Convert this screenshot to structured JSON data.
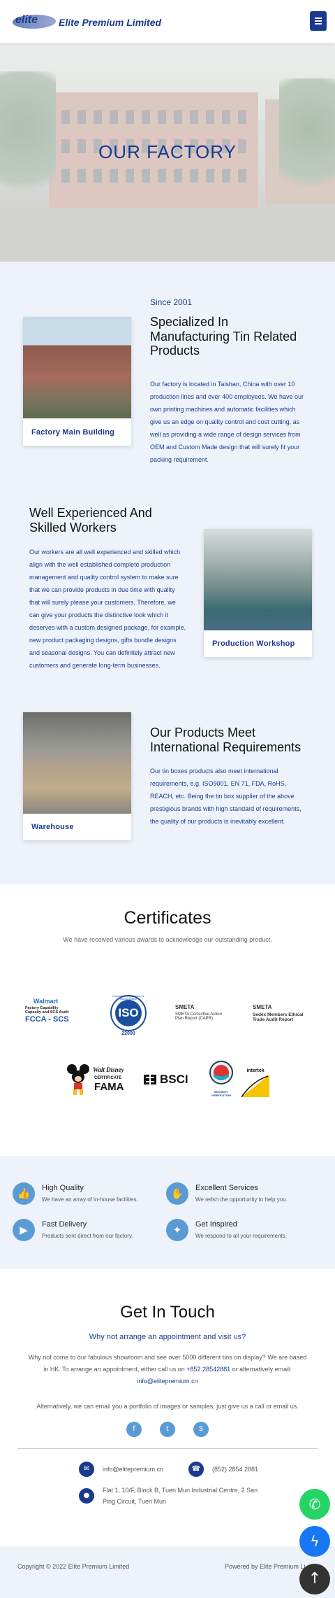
{
  "header": {
    "logo_text": "elite",
    "brand_name": "Elite Premium Limited",
    "menu_icon": "hamburger-menu-icon"
  },
  "hero": {
    "title": "OUR FACTORY"
  },
  "intro": {
    "since": "Since 2001",
    "heading": "Specialized In Manufacturing Tin Related Products",
    "body": "Our factory is located in Taishan, China with over 10 production lines and over 400 employees. We have our own printing machines and automatic facilities which give us an edge on quality control and cost cutting, as well as providing a wide range of design services from OEM and Custom Made design that will surely fit your packing requirement.",
    "image_caption": "Factory Main Building"
  },
  "workers": {
    "heading": "Well Experienced And Skilled Workers",
    "body": "Our workers are all well experienced and skilled which align with the well established complete production management and quality control system to make sure that we can provide products in due time with quality that will surely please your customers. Therefore, we can give your products the distinctive look which it deserves with a custom designed package, for example, new product packaging designs, gifts bundle designs and seasonal designs. You can definitely attract new customers and generate long-term businesses.",
    "image_caption": "Production Workshop"
  },
  "products": {
    "heading": "Our Products Meet International Requirements",
    "body": "Our tin boxes products also meet international requirements, e.g. ISO9001, EN 71, FDA, RoHS, REACH, etc. Being the tin box supplier of the above prestigious brands with high standard of requirements, the quality of our products is inevitably excellent.",
    "image_caption": "Warehouse"
  },
  "certificates": {
    "title": "Certificates",
    "subtitle": "We have received various awards to acknowledge our outstanding product.",
    "walmart": {
      "brand": "Walmart",
      "line1": "Factory Capability",
      "line2": "Capacity and SCS Audit",
      "tag": "FCCA - SCS"
    },
    "iso": {
      "text": "ISO",
      "arc": "International Organization for Standardization",
      "num": "22000"
    },
    "smeta_capr": {
      "brand": "SMETA",
      "line1": "SMETA Corrective Action",
      "line2": "Plan Report (CAPR)"
    },
    "sedex": {
      "brand": "SMETA",
      "line1": "Sedex Members Ethical",
      "line2": "Trade Audit Report"
    },
    "disney": {
      "brand": "Walt Disney",
      "line1": "CERTIFICATE",
      "line2": "FAMA"
    },
    "bsci": {
      "brand": "BSCI"
    },
    "security": {
      "line1": "SECURITY",
      "line2": "VERIFICATION"
    },
    "intertek": {
      "brand": "intertek"
    }
  },
  "features": [
    {
      "title": "High Quality",
      "desc": "We have an array of in-house facilities.",
      "icon": "thumbs-up-icon"
    },
    {
      "title": "Excellent Services",
      "desc": "We relish the opportunity to help you.",
      "icon": "handshake-icon"
    },
    {
      "title": "Fast Delivery",
      "desc": "Products sent direct from our factory.",
      "icon": "truck-icon"
    },
    {
      "title": "Get Inspired",
      "desc": "We respond to all your requirements.",
      "icon": "lightbulb-icon"
    }
  ],
  "touch": {
    "title": "Get In Touch",
    "subtitle": "Why not arrange an appointment and visit us?",
    "p1a": "Why not come to our fabulous showroom and see over 5000 different tins on display? We are",
    "p1b": "based in HK. To arrange an appointment, either call us on",
    "phone_link": "+852 28542881",
    "p1c": "or alternatively email:",
    "email_link": "info@elitepremium.cn",
    "p2": "Alternatively, we can email you a portfolio of images or samples, just give us a call or email us.",
    "social": [
      "facebook-icon",
      "twitter-icon",
      "skype-icon"
    ]
  },
  "contact": {
    "email": "info@elitepremium.cn",
    "phone": "(852) 2854 2881",
    "address1": "Flat 1, 10/F, Block B, Tuen Mun Industrial Centre, 2 San",
    "address2": "Ping Circuit, Tuen Mun"
  },
  "footer": {
    "copyright": "Copyright © 2022 Elite Premium Limited",
    "powered": "Powered by Elite Premium Li"
  },
  "fabs": [
    "whatsapp-icon",
    "messenger-icon",
    "scroll-up-icon"
  ],
  "colors": {
    "brand": "#1a3a8c",
    "accent": "#5b9bd5",
    "section_bg": "#eef3fb",
    "whatsapp": "#25d366",
    "messenger": "#1877f2"
  }
}
